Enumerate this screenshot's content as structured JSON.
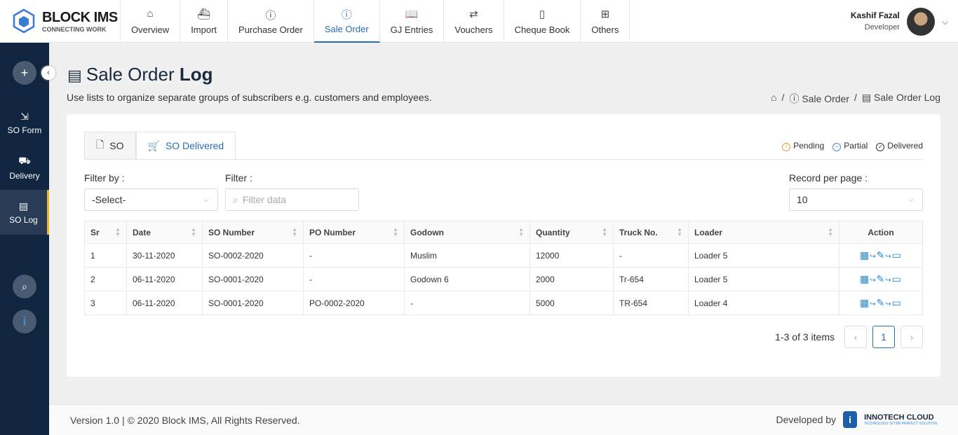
{
  "brand": {
    "name": "BLOCK IMS",
    "tagline": "CONNECTING WORK"
  },
  "nav": [
    {
      "label": "Overview",
      "icon": "⌂"
    },
    {
      "label": "Import",
      "icon": "⛴"
    },
    {
      "label": "Purchase Order",
      "icon": "ⓘ"
    },
    {
      "label": "Sale Order",
      "icon": "ⓘ"
    },
    {
      "label": "GJ Entries",
      "icon": "📖"
    },
    {
      "label": "Vouchers",
      "icon": "⇄"
    },
    {
      "label": "Cheque Book",
      "icon": "▯"
    },
    {
      "label": "Others",
      "icon": "⊞"
    }
  ],
  "user": {
    "name": "Kashif Fazal",
    "role": "Developer"
  },
  "sidebar": [
    {
      "label": "SO Form",
      "icon": "⇲"
    },
    {
      "label": "Delivery",
      "icon": "⛟"
    },
    {
      "label": "SO Log",
      "icon": "▤"
    }
  ],
  "page": {
    "title_light": "Sale Order",
    "title_bold": "Log",
    "subtitle": "Use lists to organize separate groups of subscribers e.g. customers and employees.",
    "breadcrumb": [
      "Sale Order",
      "Sale Order Log"
    ]
  },
  "tabs": [
    {
      "label": "SO"
    },
    {
      "label": "SO Delivered"
    }
  ],
  "legend": [
    {
      "label": "Pending",
      "icon": "!",
      "color": "#e0a040"
    },
    {
      "label": "Partial",
      "icon": "−",
      "color": "#4a8ad5"
    },
    {
      "label": "Delivered",
      "icon": "✓",
      "color": "#333"
    }
  ],
  "filters": {
    "filter_by_label": "Filter by :",
    "filter_by_value": "-Select-",
    "filter_label": "Filter :",
    "filter_placeholder": "Filter data",
    "rpp_label": "Record per page :",
    "rpp_value": "10"
  },
  "table": {
    "headers": [
      "Sr",
      "Date",
      "SO Number",
      "PO Number",
      "Godown",
      "Quantity",
      "Truck No.",
      "Loader",
      "Action"
    ],
    "rows": [
      [
        "1",
        "30-11-2020",
        "SO-0002-2020",
        "-",
        "Muslim",
        "12000",
        "-",
        "Loader 5"
      ],
      [
        "2",
        "06-11-2020",
        "SO-0001-2020",
        "-",
        "Godown 6",
        "2000",
        "Tr-654",
        "Loader 5"
      ],
      [
        "3",
        "06-11-2020",
        "SO-0001-2020",
        "PO-0002-2020",
        "-",
        "5000",
        "TR-654",
        "Loader 4"
      ]
    ]
  },
  "pagination": {
    "summary": "1-3 of 3 items",
    "current": "1"
  },
  "footer": {
    "copyright": "Version 1.0 | © 2020 Block IMS, All Rights Reserved.",
    "developed_by": "Developed by",
    "dev_name": "INNOTECH CLOUD",
    "dev_tagline": "TECHNOLOGY IS THE PERFECT SOLUTION"
  }
}
